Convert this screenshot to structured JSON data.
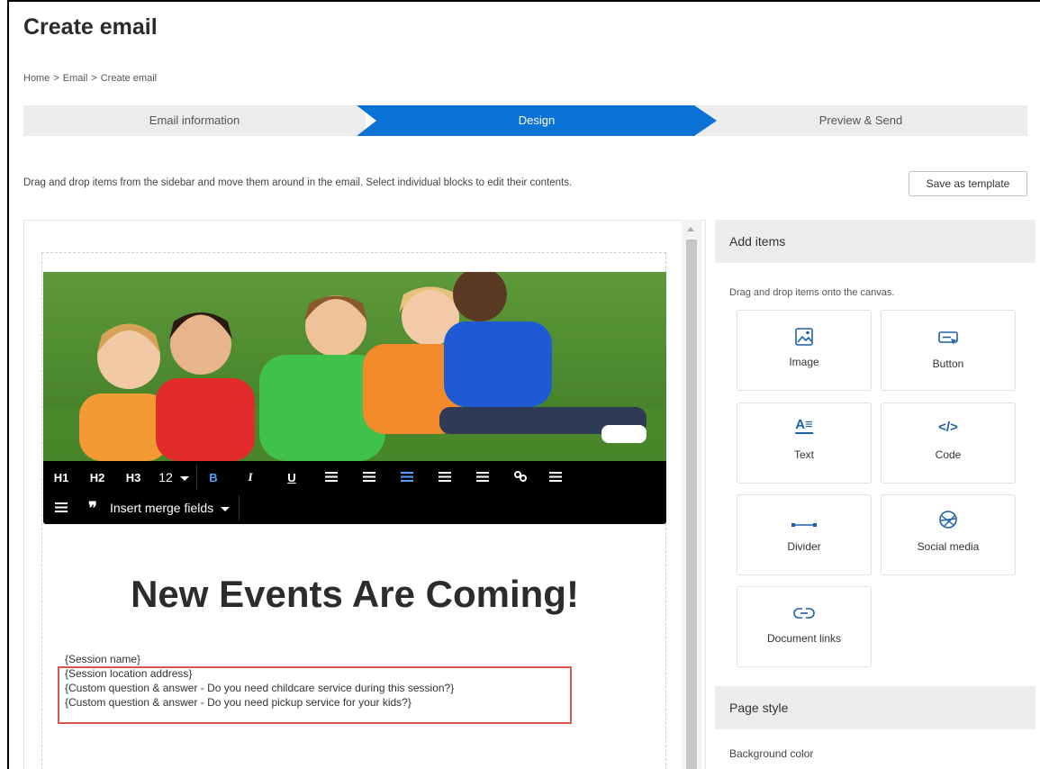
{
  "page": {
    "title": "Create email",
    "breadcrumb": [
      "Home",
      "Email",
      "Create email"
    ],
    "breadcrumb_separator": ">"
  },
  "steps": [
    {
      "label": "Email information",
      "active": false
    },
    {
      "label": "Design",
      "active": true
    },
    {
      "label": "Preview & Send",
      "active": false
    }
  ],
  "instructions": "Drag and drop items from the sidebar and move them around in the email. Select individual blocks to edit their contents.",
  "save_template_label": "Save as template",
  "toolbar": {
    "h1": "H1",
    "h2": "H2",
    "h3": "H3",
    "font_size": "12",
    "bold": "B",
    "italic": "I",
    "underline": "U",
    "merge_label": "Insert merge fields"
  },
  "email": {
    "headline": "New Events Are Coming!",
    "merge_lines": [
      "{Session name}",
      "{Session location address}",
      "{Custom question & answer - Do you need childcare service during this session?}",
      "{Custom question & answer - Do you need pickup service for your kids?}"
    ]
  },
  "sidebar": {
    "add_items_title": "Add items",
    "add_items_desc": "Drag and drop items onto the canvas.",
    "items": [
      {
        "label": "Image",
        "icon": "image-icon"
      },
      {
        "label": "Button",
        "icon": "button-icon"
      },
      {
        "label": "Text",
        "icon": "text-icon"
      },
      {
        "label": "Code",
        "icon": "code-icon"
      },
      {
        "label": "Divider",
        "icon": "divider-icon"
      },
      {
        "label": "Social media",
        "icon": "globe-icon"
      },
      {
        "label": "Document links",
        "icon": "link-icon"
      }
    ],
    "page_style_title": "Page style",
    "background_color_label": "Background color"
  },
  "colors": {
    "accent": "#0b72d6",
    "highlight": "#d9534f",
    "icon": "#1f5fa8"
  }
}
